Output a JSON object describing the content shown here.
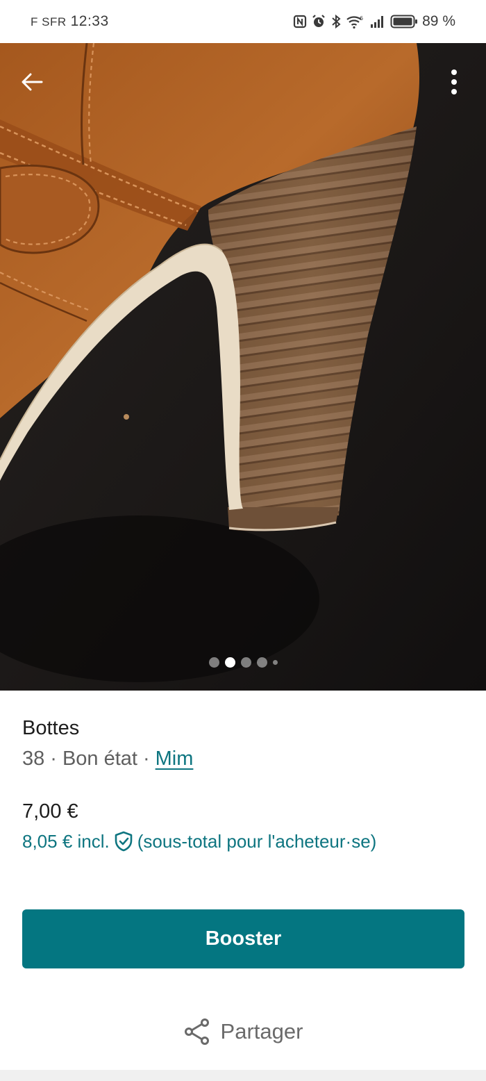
{
  "status_bar": {
    "carrier": "F SFR",
    "time": "12:33",
    "battery": "89 %",
    "icons": [
      "nfc-icon",
      "alarm-icon",
      "bluetooth-icon",
      "wifi-icon",
      "signal-icon",
      "battery-icon"
    ]
  },
  "photo": {
    "description_icons": [
      "back-arrow-icon",
      "more-vert-icon"
    ],
    "carousel": {
      "total": 5,
      "active_index": 1
    }
  },
  "item": {
    "title": "Bottes",
    "size": "38",
    "condition": "Bon état",
    "brand": "Mim",
    "separator": "·",
    "price": "7,00 €",
    "buyer_price": "8,05 € incl.",
    "buyer_note": "(sous-total pour l'acheteur·se)"
  },
  "actions": {
    "booster_label": "Booster",
    "share_label": "Partager"
  },
  "colors": {
    "accent": "#047681",
    "link": "#0e7580"
  }
}
